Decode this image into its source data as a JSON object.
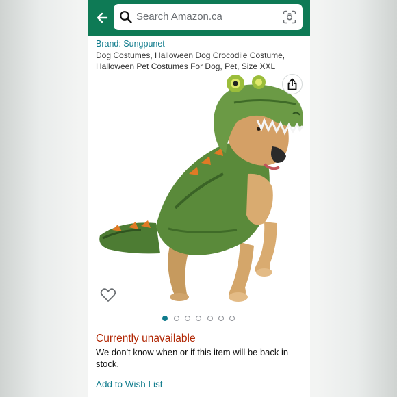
{
  "header": {
    "search_placeholder": "Search Amazon.ca",
    "back_icon": "arrow-left-icon",
    "search_icon": "search-icon",
    "camera_icon": "camera-scan-icon",
    "bar_color": "#0e7a55"
  },
  "product": {
    "brand": "Brand: Sungpunet",
    "title": "Dog Costumes, Halloween Dog Crocodile Costume, Halloween Pet Costumes For Dog, Pet, Size XXL",
    "share_icon": "share-icon",
    "wishlist_icon": "heart-outline-icon"
  },
  "gallery": {
    "image_count": 7,
    "active_index": 0
  },
  "availability": {
    "status": "Currently unavailable",
    "message": "We don't know when or if this item will be back in stock.",
    "status_color": "#b12704"
  },
  "actions": {
    "add_to_wish_list": "Add to Wish List",
    "link_color": "#0f7b8c"
  }
}
